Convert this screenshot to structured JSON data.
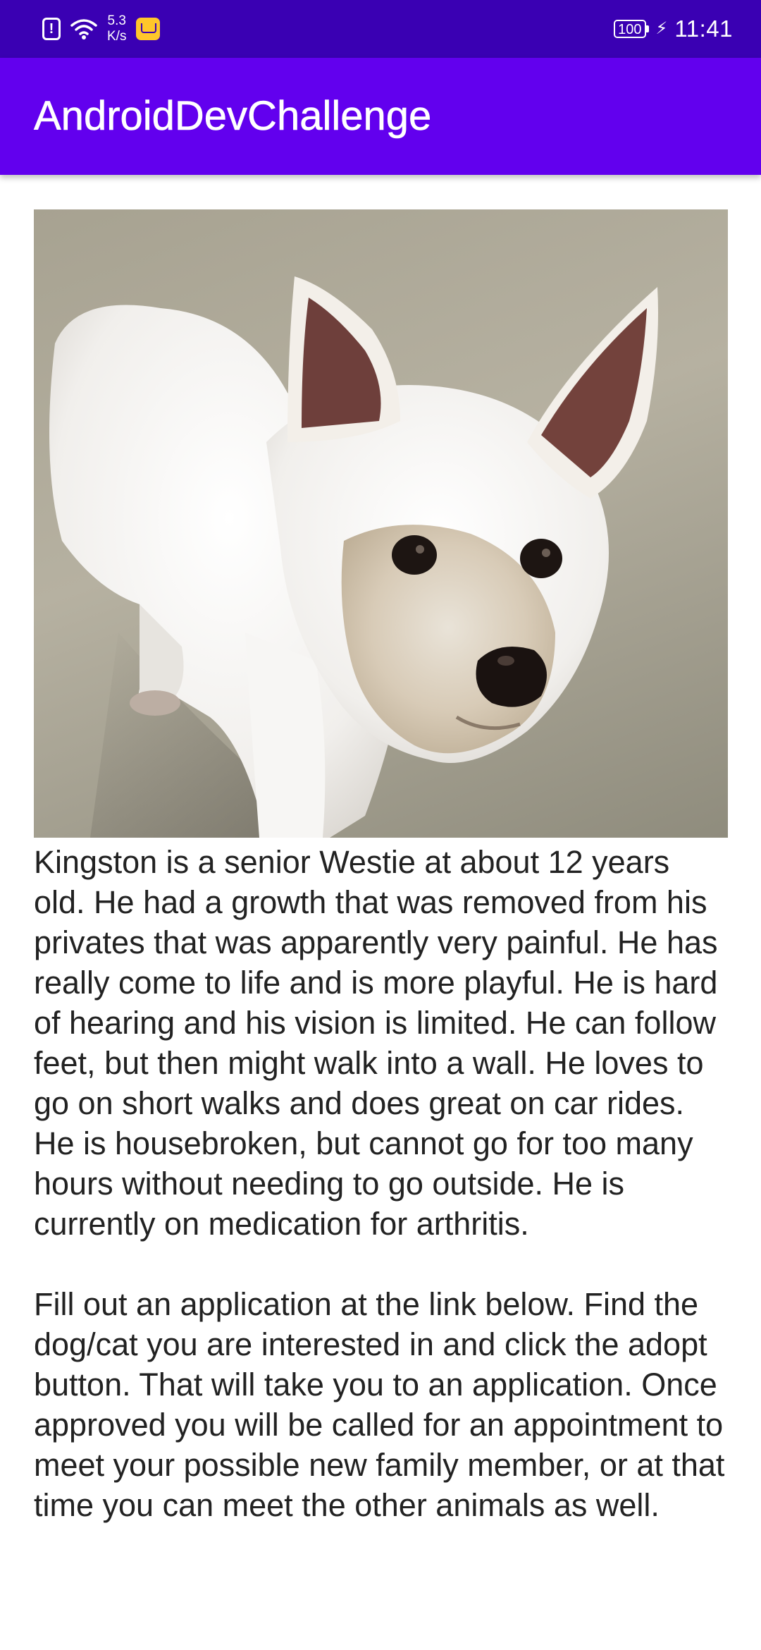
{
  "status_bar": {
    "network_speed_value": "5.3",
    "network_speed_unit": "K/s",
    "battery_level": "100",
    "time": "11:41",
    "icons": [
      "alert-icon",
      "wifi-icon",
      "message-icon",
      "battery-icon",
      "charging-bolt-icon"
    ]
  },
  "app_bar": {
    "title": "AndroidDevChallenge"
  },
  "pet": {
    "photo_icon": "dog-photo",
    "description": "Kingston is a senior Westie at about 12 years old. He had a growth that was removed from his privates that was apparently very painful. He has really come to life and is more playful. He is hard of hearing and his vision is limited. He can follow feet, but then might walk into a wall. He loves to go on short walks and does great on car rides. He is housebroken, but cannot go for too many hours without needing to go outside. He is currently on medication for arthritis.\n\nFill out an application at the link below. Find the dog/cat you are interested in and click the adopt button. That will take you to an application. Once approved you will be called for an appointment to meet your possible new family member, or at that time you can meet the other animals as well."
  },
  "colors": {
    "status_bar": "#3a00b3",
    "app_bar": "#6200ee",
    "text": "#222222"
  }
}
